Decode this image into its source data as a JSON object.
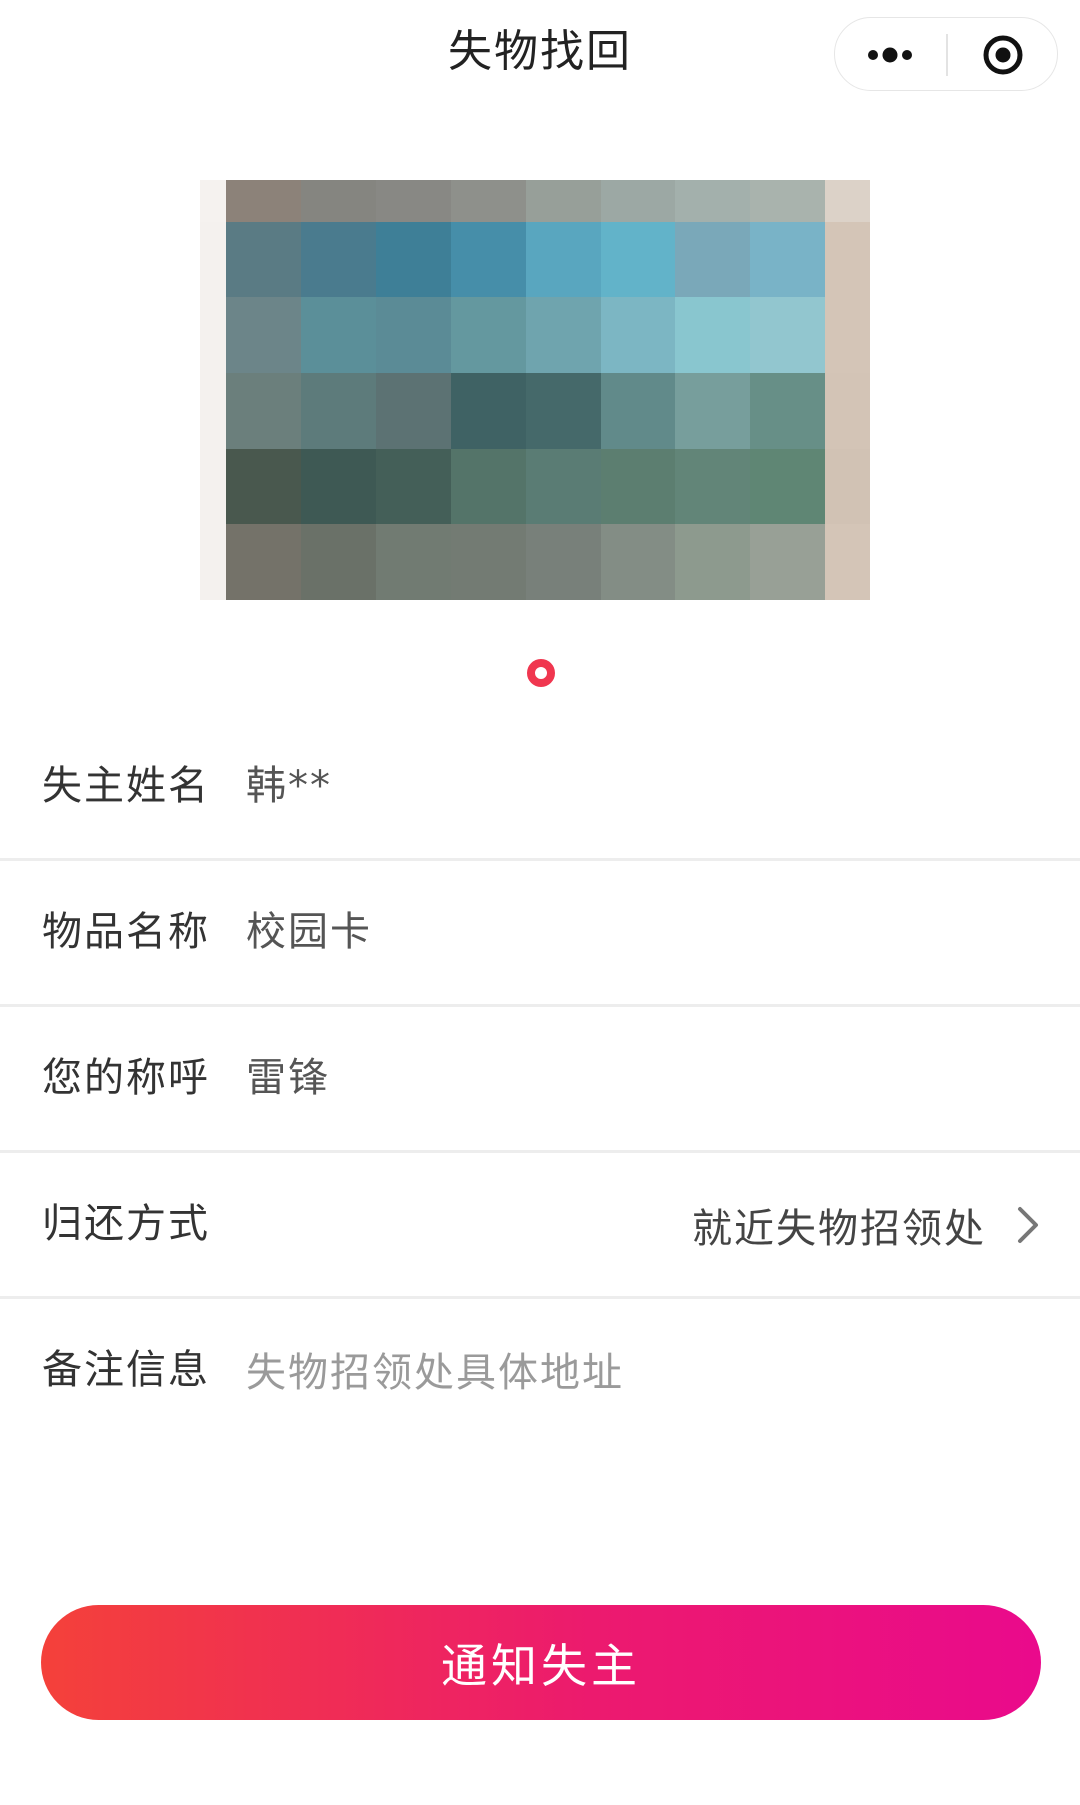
{
  "navbar": {
    "title": "失物找回",
    "more_icon": "more-dots-icon",
    "close_icon": "target-close-icon"
  },
  "swiper": {
    "image_description": "photo of lost item (pixelated)",
    "page_count": 1,
    "active_index": 0,
    "indicator_color": "#f0364f",
    "pixel_colors": [
      [
        "#f5f2ef",
        "#8c8279",
        "#858580",
        "#888884",
        "#8e908b",
        "#979f99",
        "#9ca8a4",
        "#a3b0ac",
        "#a9b3ad",
        "#dcd2c8"
      ],
      [
        "#f4f1ee",
        "#5a7b84",
        "#4a7b8e",
        "#3e7f97",
        "#468ea9",
        "#59a6bf",
        "#62b3c9",
        "#7aa8b9",
        "#79b3c7",
        "#d4c5b7"
      ],
      [
        "#f4f1ee",
        "#6c8589",
        "#5b8f99",
        "#5b8b96",
        "#64989f",
        "#6fa4ae",
        "#7cb6c3",
        "#89c6cf",
        "#92c6cf",
        "#d4c5b7"
      ],
      [
        "#f4f1ee",
        "#6b7f7c",
        "#5d7b7b",
        "#5c7273",
        "#3f6264",
        "#45696a",
        "#618a8a",
        "#779e9c",
        "#678f87",
        "#d3c4b6"
      ],
      [
        "#f4f1ee",
        "#49584e",
        "#3e5954",
        "#445f58",
        "#547469",
        "#5a7c74",
        "#5c7e70",
        "#628578",
        "#5f8674",
        "#d1c2b4"
      ],
      [
        "#f4f1ee",
        "#747269",
        "#6a7168",
        "#717b72",
        "#737b73",
        "#78807a",
        "#838d85",
        "#8d9a8e",
        "#98a096",
        "#d4c5b7"
      ]
    ]
  },
  "form": {
    "owner_name": {
      "label": "失主姓名",
      "value": "韩**"
    },
    "item_name": {
      "label": "物品名称",
      "value": "校园卡"
    },
    "your_name": {
      "label": "您的称呼",
      "value": "雷锋"
    },
    "return_method": {
      "label": "归还方式",
      "value": "就近失物招领处",
      "icon": "chevron-right-icon"
    },
    "remarks": {
      "label": "备注信息",
      "value": "",
      "placeholder": "失物招领处具体地址"
    }
  },
  "submit": {
    "label": "通知失主",
    "gradient_start": "#f4413a",
    "gradient_end": "#ea0a8c"
  }
}
